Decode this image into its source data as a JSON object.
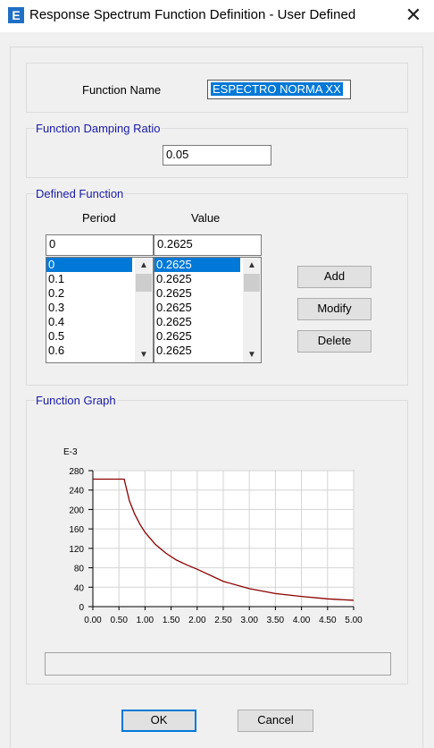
{
  "window": {
    "title": "Response Spectrum Function Definition - User Defined",
    "app_icon": "E",
    "close_glyph": "✕"
  },
  "function_name": {
    "label": "Function Name",
    "value": "ESPECTRO NORMA XX"
  },
  "damping": {
    "group_label": "Function Damping Ratio",
    "value": "0.05"
  },
  "defined_function": {
    "group_label": "Defined Function",
    "period_header": "Period",
    "value_header": "Value",
    "period_input": "0",
    "value_input": "0.2625",
    "periods": [
      "0",
      "0.1",
      "0.2",
      "0.3",
      "0.4",
      "0.5",
      "0.6"
    ],
    "values": [
      "0.2625",
      "0.2625",
      "0.2625",
      "0.2625",
      "0.2625",
      "0.2625",
      "0.2625"
    ],
    "add_label": "Add",
    "modify_label": "Modify",
    "delete_label": "Delete",
    "scroll_up_icon": "chevron-up",
    "scroll_down_icon": "chevron-down"
  },
  "graph": {
    "group_label": "Function Graph"
  },
  "chart_data": {
    "type": "line",
    "multiplier_label": "E-3",
    "xlim": [
      0,
      5
    ],
    "ylim": [
      0,
      280
    ],
    "x_ticks": [
      "0.00",
      "0.50",
      "1.00",
      "1.50",
      "2.00",
      "2.50",
      "3.00",
      "3.50",
      "4.00",
      "4.50",
      "5.00"
    ],
    "y_ticks": [
      "280",
      "240",
      "200",
      "160",
      "120",
      "80",
      "40",
      "0"
    ],
    "grid": true,
    "line_color": "#8b0000",
    "series": [
      {
        "x": [
          0,
          0.1,
          0.2,
          0.3,
          0.4,
          0.5,
          0.6,
          0.7,
          0.8,
          0.9,
          1.0,
          1.2,
          1.4,
          1.6,
          1.8,
          2.0,
          2.5,
          3.0,
          3.5,
          4.0,
          4.5,
          5.0
        ],
        "y": [
          262.5,
          262.5,
          262.5,
          262.5,
          262.5,
          262.5,
          262.5,
          218,
          191,
          170,
          153,
          128,
          110,
          96,
          86,
          77,
          52,
          37,
          27,
          21,
          16,
          13
        ]
      }
    ]
  },
  "buttons": {
    "ok_label": "OK",
    "cancel_label": "Cancel"
  }
}
